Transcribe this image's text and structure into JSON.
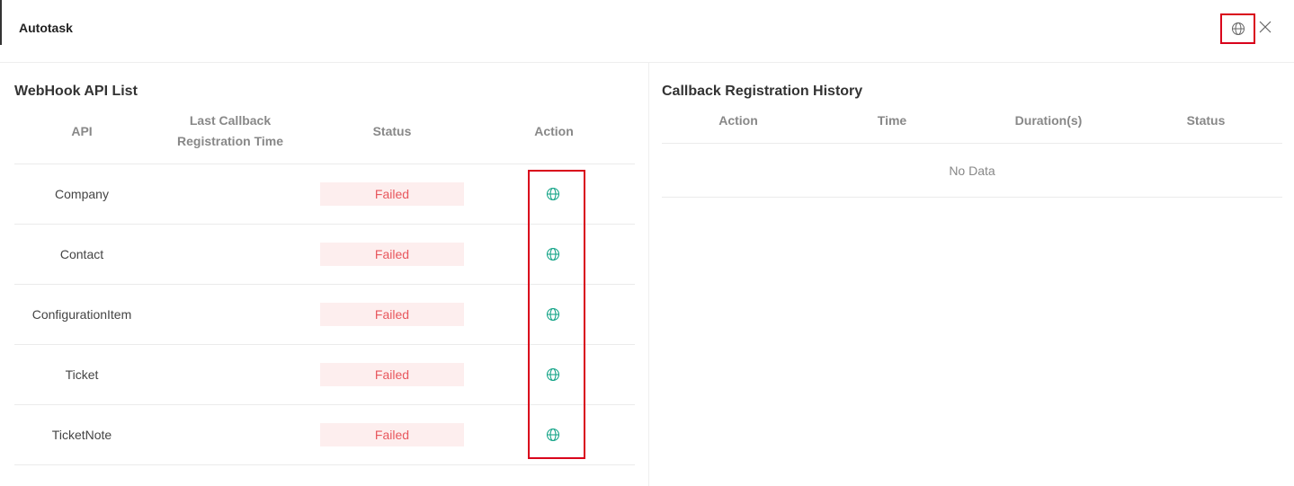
{
  "header": {
    "title": "Autotask",
    "globe_icon": "globe-icon",
    "close_icon": "close-icon"
  },
  "webhook": {
    "title": "WebHook API List",
    "columns": {
      "api": "API",
      "last_callback_line1": "Last Callback",
      "last_callback_line2": "Registration Time",
      "status": "Status",
      "action": "Action"
    },
    "rows": [
      {
        "api": "Company",
        "time": "",
        "status": "Failed"
      },
      {
        "api": "Contact",
        "time": "",
        "status": "Failed"
      },
      {
        "api": "ConfigurationItem",
        "time": "",
        "status": "Failed"
      },
      {
        "api": "Ticket",
        "time": "",
        "status": "Failed"
      },
      {
        "api": "TicketNote",
        "time": "",
        "status": "Failed"
      }
    ]
  },
  "history": {
    "title": "Callback Registration History",
    "columns": {
      "action": "Action",
      "time": "Time",
      "duration": "Duration(s)",
      "status": "Status"
    },
    "empty_text": "No Data"
  },
  "colors": {
    "accent": "#17a589",
    "failed_text": "#e8585e",
    "failed_bg": "#fdeeee",
    "highlight": "#d9001b"
  }
}
